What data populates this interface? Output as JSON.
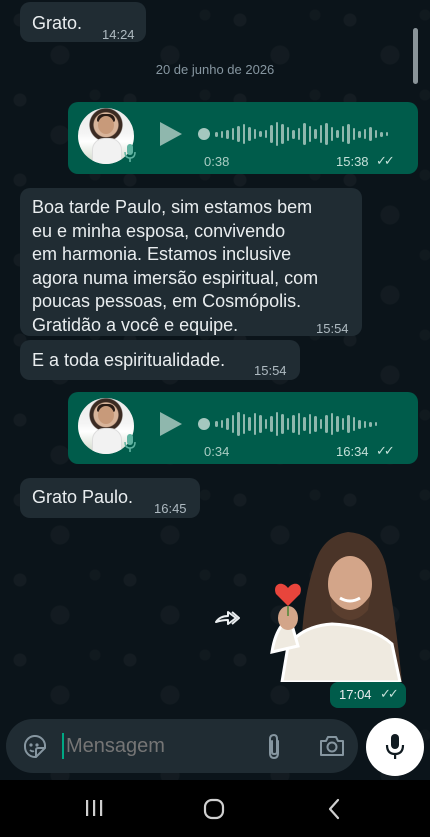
{
  "colors": {
    "chat_background": "#0b141a",
    "incoming_bubble": "#202c33",
    "outgoing_bubble": "#005c4b",
    "accent": "#00a884"
  },
  "date_divider": "20 de junho de 2026",
  "messages": {
    "m1": {
      "text": "Grato.",
      "time": "14:24"
    },
    "audio1": {
      "duration": "0:38",
      "time": "15:38",
      "status_icon": "double-check-icon"
    },
    "m2": {
      "lines": [
        "Boa tarde Paulo, sim estamos bem",
        "eu e minha esposa, convivendo",
        "em harmonia. Estamos inclusive",
        "agora numa imersão espiritual, com",
        "poucas pessoas, em Cosmópolis.",
        "Gratidão a você e equipe."
      ],
      "time": "15:54"
    },
    "m3": {
      "text": "E a toda espiritualidade.",
      "time": "15:54"
    },
    "audio2": {
      "duration": "0:34",
      "time": "16:34",
      "status_icon": "double-check-icon"
    },
    "m4": {
      "text": "Grato Paulo.",
      "time": "16:45"
    },
    "sticker": {
      "time": "17:04",
      "status_icon": "double-check-icon"
    }
  },
  "input": {
    "placeholder": "Mensagem"
  },
  "icons": {
    "emoji": "sticker-emoji-icon",
    "attach": "paperclip-icon",
    "camera": "camera-icon",
    "mic": "microphone-icon",
    "forward": "forward-icon"
  }
}
